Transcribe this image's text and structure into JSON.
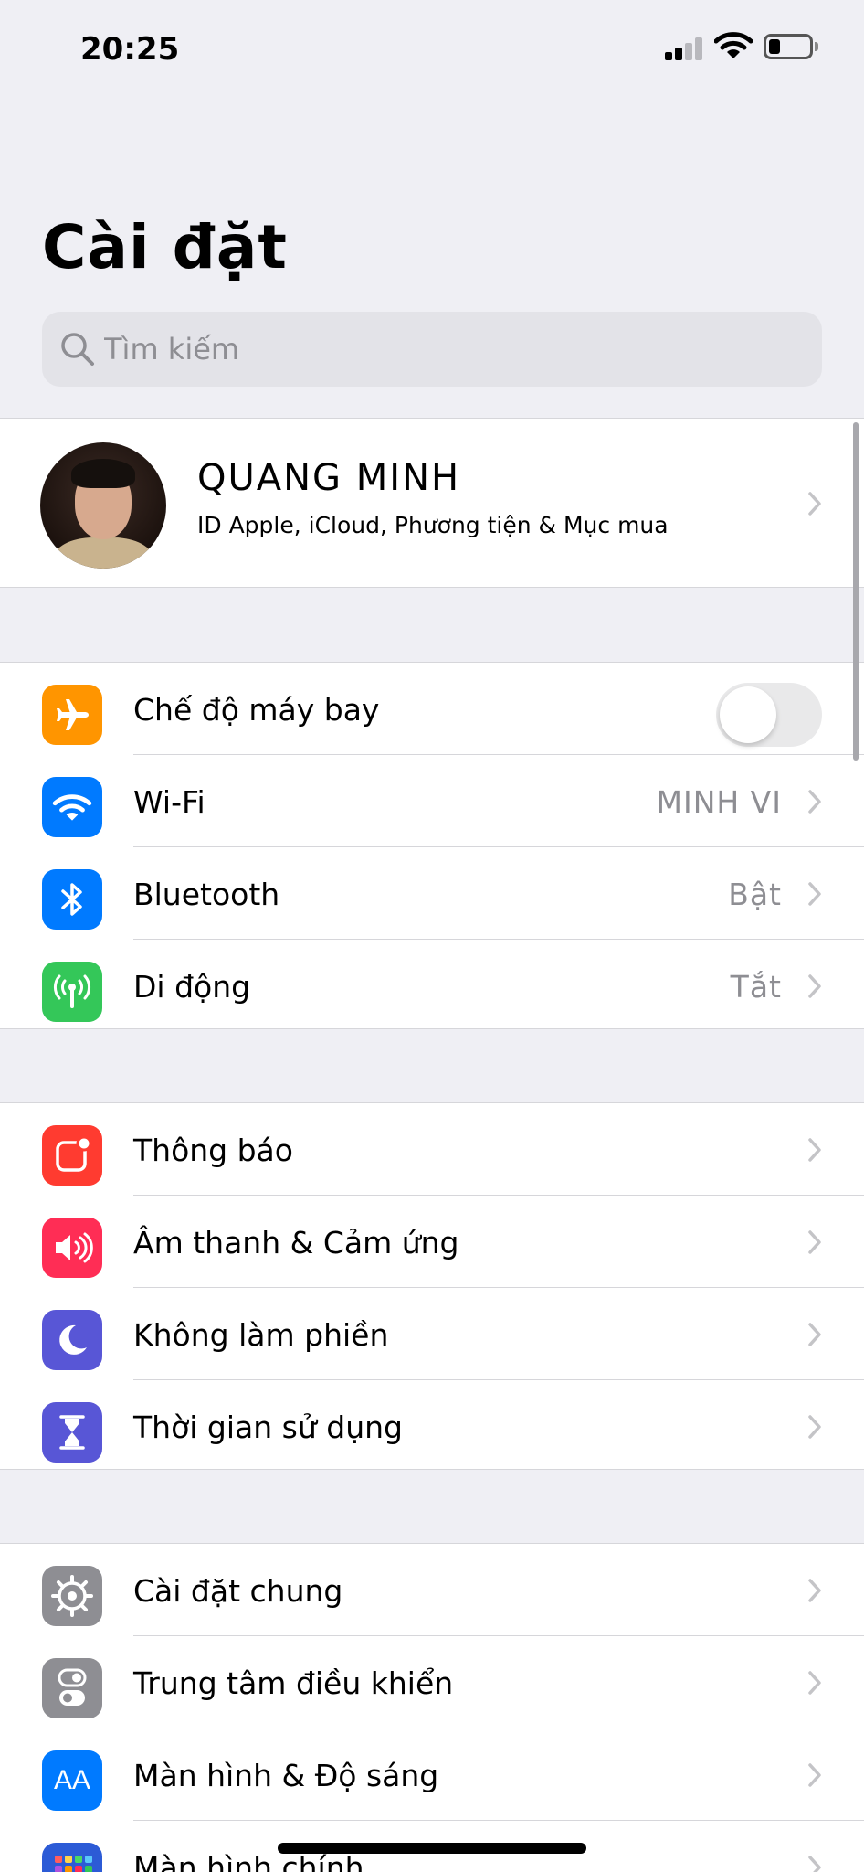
{
  "status_bar": {
    "time": "20:25"
  },
  "page": {
    "title": "Cài đặt"
  },
  "search": {
    "placeholder": "Tìm kiếm"
  },
  "profile": {
    "name": "QUANG MINH",
    "subtitle": "ID Apple, iCloud, Phương tiện & Mục mua"
  },
  "connectivity": {
    "airplane": {
      "label": "Chế độ máy bay",
      "enabled": false,
      "icon": "airplane-icon",
      "color": "#ff9500"
    },
    "wifi": {
      "label": "Wi-Fi",
      "value": "MINH VI",
      "icon": "wifi-icon",
      "color": "#007aff"
    },
    "bluetooth": {
      "label": "Bluetooth",
      "value": "Bật",
      "icon": "bluetooth-icon",
      "color": "#007aff"
    },
    "cellular": {
      "label": "Di động",
      "value": "Tắt",
      "icon": "cellular-antenna-icon",
      "color": "#34c759"
    }
  },
  "notifications_group": {
    "notifications": {
      "label": "Thông báo",
      "icon": "notifications-icon",
      "color": "#ff3b30"
    },
    "sounds": {
      "label": "Âm thanh & Cảm ứng",
      "icon": "speaker-icon",
      "color": "#ff2d55"
    },
    "do_not_disturb": {
      "label": "Không làm phiền",
      "icon": "moon-icon",
      "color": "#5856d6"
    },
    "screen_time": {
      "label": "Thời gian sử dụng",
      "icon": "hourglass-icon",
      "color": "#5856d6"
    }
  },
  "general_group": {
    "general": {
      "label": "Cài đặt chung",
      "icon": "gear-icon",
      "color": "#8e8e93"
    },
    "control_center": {
      "label": "Trung tâm điều khiển",
      "icon": "toggles-icon",
      "color": "#8e8e93"
    },
    "display": {
      "label": "Màn hình & Độ sáng",
      "icon": "text-size-icon",
      "color": "#007aff",
      "icon_text": "AA"
    },
    "home_screen": {
      "label": "Màn hình chính",
      "icon": "home-screen-grid-icon",
      "color": "#2c5bd6"
    }
  }
}
